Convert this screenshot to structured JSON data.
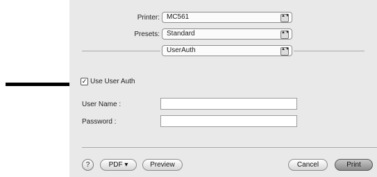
{
  "printer": {
    "label": "Printer:",
    "value": "MC561"
  },
  "presets": {
    "label": "Presets:",
    "value": "Standard"
  },
  "panel": {
    "value": "UserAuth"
  },
  "use_user_auth": {
    "label": "Use User Auth",
    "checked": true,
    "check_glyph": "✓"
  },
  "user_name": {
    "label": "User Name :",
    "value": ""
  },
  "password": {
    "label": "Password :",
    "value": ""
  },
  "footer": {
    "help_glyph": "?",
    "pdf_label": "PDF ▾",
    "preview_label": "Preview",
    "cancel_label": "Cancel",
    "print_label": "Print"
  },
  "popup_arrows_glyph": "▲▼",
  "icons": {
    "annotation_arrow": "arrow-right-icon",
    "popup_arrows": "updown-arrows-icon",
    "help": "help-icon",
    "check": "checkmark-icon"
  }
}
